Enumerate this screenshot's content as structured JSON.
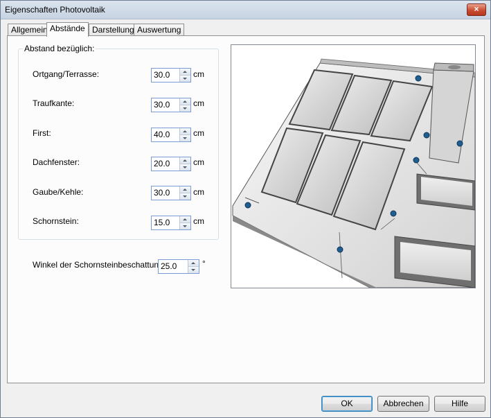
{
  "window": {
    "title": "Eigenschaften Photovoltaik",
    "close_glyph": "×"
  },
  "tabs": [
    {
      "label": "Allgemein"
    },
    {
      "label": "Abstände"
    },
    {
      "label": "Darstellung"
    },
    {
      "label": "Auswertung"
    }
  ],
  "active_tab": "Abstände",
  "group": {
    "legend": "Abstand bezüglich:",
    "rows": [
      {
        "label": "Ortgang/Terrasse:",
        "value": "30.0",
        "unit": "cm"
      },
      {
        "label": "Traufkante:",
        "value": "30.0",
        "unit": "cm"
      },
      {
        "label": "First:",
        "value": "40.0",
        "unit": "cm"
      },
      {
        "label": "Dachfenster:",
        "value": "20.0",
        "unit": "cm"
      },
      {
        "label": "Gaube/Kehle:",
        "value": "30.0",
        "unit": "cm"
      },
      {
        "label": "Schornstein:",
        "value": "15.0",
        "unit": "cm"
      }
    ]
  },
  "shading": {
    "label": "Winkel der Schornsteinbeschattung:",
    "value": "25.0",
    "unit": "°"
  },
  "buttons": {
    "ok": "OK",
    "cancel": "Abbrechen",
    "help": "Hilfe"
  },
  "colors": {
    "accent": "#3c7fb1",
    "marker": "#1f5e8f"
  }
}
